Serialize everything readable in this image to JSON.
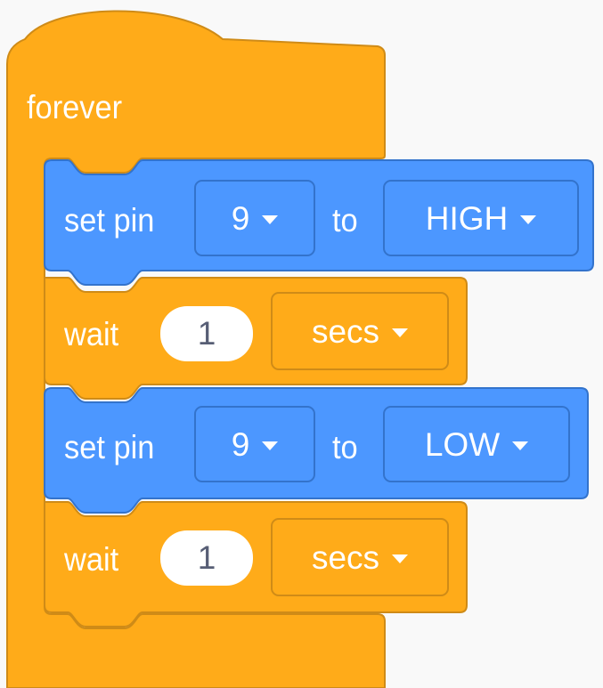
{
  "forever_block": {
    "label": "forever",
    "color": "#ffab19",
    "border": "#cf8b17"
  },
  "blocks": [
    {
      "kind": "set_pin",
      "label": "set pin",
      "pin": "9",
      "to_label": "to",
      "state": "HIGH",
      "color": "#4c97ff"
    },
    {
      "kind": "wait",
      "label": "wait",
      "value": "1",
      "unit": "secs",
      "color": "#ffab19"
    },
    {
      "kind": "set_pin",
      "label": "set pin",
      "pin": "9",
      "to_label": "to",
      "state": "LOW",
      "color": "#4c97ff"
    },
    {
      "kind": "wait",
      "label": "wait",
      "value": "1",
      "unit": "secs",
      "color": "#ffab19"
    }
  ],
  "icons": {
    "dropdown_caret": "caret-down-icon"
  }
}
